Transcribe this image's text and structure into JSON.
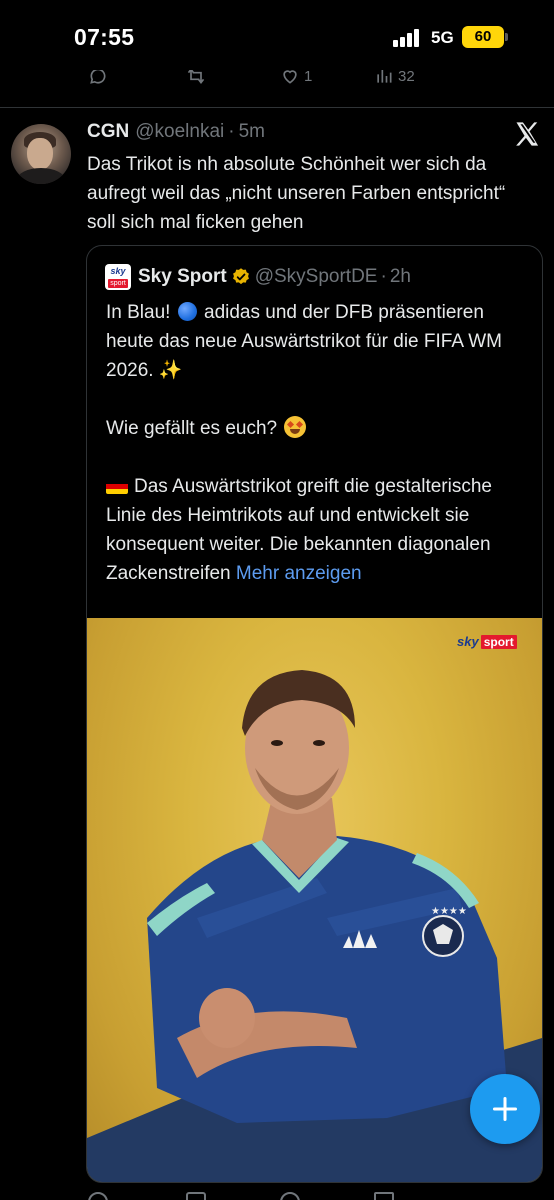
{
  "status_bar": {
    "time": "07:55",
    "network": "5G",
    "battery": "60"
  },
  "previous_tweet": {
    "like_count": "1",
    "view_count": "32"
  },
  "tweet": {
    "display_name": "CGN",
    "handle": "@koelnkai",
    "separator": "·",
    "time_ago": "5m",
    "text": "Das Trikot is nh absolute Schönheit wer sich da aufregt weil das „nicht unseren Farben entspricht“ soll sich mal ficken gehen"
  },
  "quote": {
    "avatar_top": "sky",
    "avatar_bottom": "sport",
    "display_name": "Sky Sport",
    "handle": "@SkySportDE",
    "separator": "·",
    "time_ago": "2h",
    "line1_a": "In Blau!",
    "line1_b": "adidas und der DFB präsentieren heute das neue Auswärtstrikot für die FIFA WM 2026.",
    "sparkles": "✨",
    "line2": "Wie gefällt es euch?",
    "line3": "Das Auswärtstrikot greift die gestalterische Linie des Heimtrikots auf und entwickelt sie konsequent weiter. Die bekannten diagonalen Zackenstreifen",
    "more_link": "Mehr anzeigen",
    "media_logo_sky": "sky",
    "media_logo_sport": "sport"
  },
  "colors": {
    "background": "#000000",
    "text": "#e7e9ea",
    "muted": "#71767b",
    "link": "#5d9cf0",
    "accent": "#1d9bf0",
    "battery": "#ffd60a"
  },
  "icons": {
    "signal": "signal-bars-icon",
    "close": "x-logo-icon",
    "verified": "verified-badge-icon",
    "compose": "plus-icon"
  }
}
